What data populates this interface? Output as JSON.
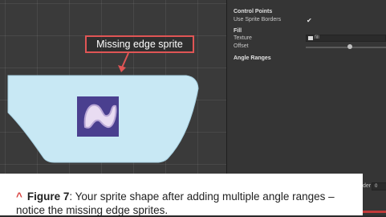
{
  "callout": {
    "label": "Missing edge sprite"
  },
  "inspector": {
    "control_points": "Control Points",
    "use_sprite_borders": "Use Sprite Borders",
    "use_sprite_borders_checked": "✔",
    "fill": "Fill",
    "texture": "Texture",
    "texture_value": "fill",
    "offset": "Offset",
    "angle_ranges": "Angle Ranges",
    "order_label": "der",
    "order_value": "0"
  },
  "caption": {
    "figure": "Figure 7",
    "text": ": Your sprite shape after adding multiple angle ranges – notice the missing edge sprites."
  },
  "colors": {
    "shape_fill": "#c8e8f4",
    "callout_border": "#e05555",
    "dial_ring": "#4a7fb0",
    "dial_top": "#2f5d92",
    "caption_accent": "#d8423f"
  }
}
